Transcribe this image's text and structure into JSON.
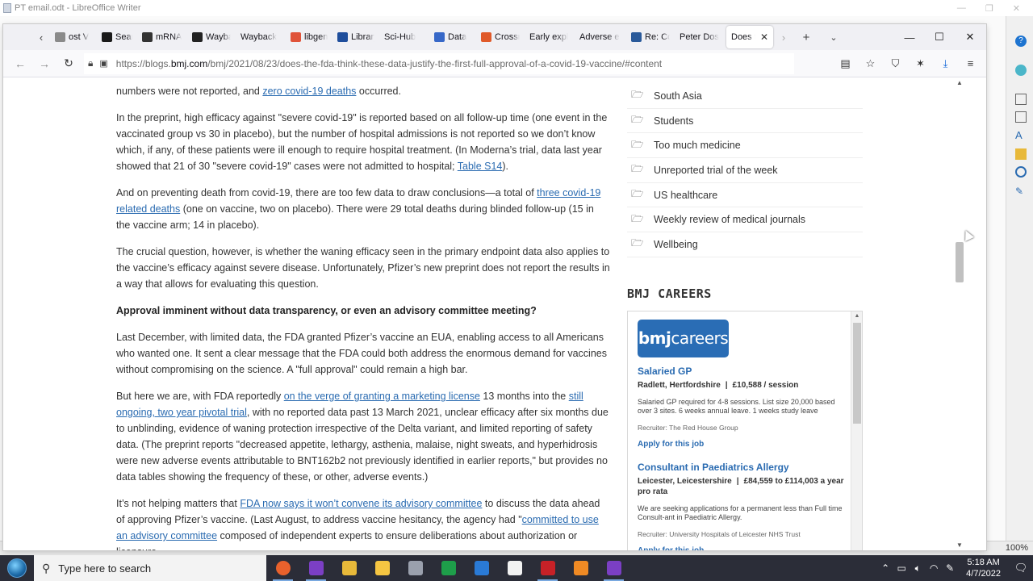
{
  "libreoffice": {
    "title": "PT email.odt - LibreOffice Writer",
    "zoom": "100%"
  },
  "firefox": {
    "tabs": [
      {
        "label": "ost V",
        "icon": "generic-tab-icon",
        "color": "#8a8a8a"
      },
      {
        "label": "Search",
        "icon": "ct-icon",
        "color": "#1a1a1a"
      },
      {
        "label": "mRNA",
        "icon": "arrow-icon",
        "color": "#333333"
      },
      {
        "label": "Wayback",
        "icon": "wayback-icon",
        "color": "#222222"
      },
      {
        "label": "Wayback",
        "icon": "none",
        "color": "#ffffff"
      },
      {
        "label": "libgen",
        "icon": "libgen-icon",
        "color": "#e0533a"
      },
      {
        "label": "Library",
        "icon": "library-icon",
        "color": "#1f4e9c"
      },
      {
        "label": "Sci-Hub",
        "icon": "none",
        "color": "#ffffff"
      },
      {
        "label": "Data",
        "icon": "data-icon",
        "color": "#3768c8"
      },
      {
        "label": "Crossref",
        "icon": "crossref-icon",
        "color": "#e05a2a"
      },
      {
        "label": "Early expl",
        "icon": "none",
        "color": "#ffffff"
      },
      {
        "label": "Adverse e",
        "icon": "none",
        "color": "#ffffff"
      },
      {
        "label": "Re: Co",
        "icon": "bmj-icon",
        "color": "#2a5a9a"
      },
      {
        "label": "Peter Dos",
        "icon": "none",
        "color": "#ffffff"
      },
      {
        "label": "Does th",
        "icon": "none",
        "color": "#ffffff",
        "active": true
      }
    ],
    "url_prefix": "https://blogs.",
    "url_domain": "bmj.com",
    "url_rest": "/bmj/2021/08/23/does-the-fda-think-these-data-justify-the-first-full-approval-of-a-covid-19-vaccine/#content"
  },
  "article": {
    "p0_text": "numbers were not reported, and ",
    "p0_link": "zero covid-19 deaths",
    "p0_tail": " occurred.",
    "p1_a": "In the preprint, high efficacy against \"severe covid-19\" is reported based on all follow-up time (one event in the vaccinated group vs 30 in placebo), but the number of hospital admissions is not reported so we don’t know which, if any, of these patients were ill enough to require hospital treatment. (In Moderna’s trial, data last year showed that 21 of 30 \"severe covid-19\" cases were not admitted to hospital; ",
    "p1_link": "Table S14",
    "p1_b": ").",
    "p2_a": "And on preventing death from covid-19, there are too few data to draw conclusions—a total of ",
    "p2_link": "three covid-19 related deaths",
    "p2_b": " (one on vaccine, two on placebo). There were 29 total deaths during blinded follow-up (15 in the vaccine arm; 14 in placebo).",
    "p3": "The crucial question, however, is whether the waning efficacy seen in the primary endpoint data also applies to the vaccine’s efficacy against severe disease. Unfortunately, Pfizer’s new preprint does not report the results in a way that allows for evaluating this question.",
    "heading": "Approval imminent without data transparency, or even an advisory committee meeting?",
    "p4": "Last December, with limited data, the FDA granted Pfizer’s vaccine an EUA, enabling access to all Americans who wanted one. It sent a clear message that the FDA could both address the enormous demand for vaccines without compromising on the science. A \"full approval\" could remain a high bar.",
    "p5_a": "But here we are, with FDA reportedly ",
    "p5_link1": "on the verge of granting a marketing license",
    "p5_b": " 13 months into the ",
    "p5_link2": "still ongoing, two year pivotal trial",
    "p5_c": ", with no reported data past 13 March 2021, unclear efficacy after six months due to unblinding, evidence of waning protection irrespective of the Delta variant, and limited reporting of safety data. (The preprint reports \"decreased appetite, lethargy, asthenia, malaise, night sweats, and hyperhidrosis were new adverse events attributable to BNT162b2 not previously identified in earlier reports,\" but provides no data tables showing the frequency of these, or other, adverse events.)",
    "p6_a": "It’s not helping matters that ",
    "p6_link1": "FDA now says it won’t convene its advisory committee",
    "p6_b": " to discuss the data ahead of approving Pfizer’s vaccine. (Last August, to address vaccine hesitancy, the agency had \"",
    "p6_link2": "committed to use an advisory committee",
    "p6_c": " composed of independent experts to ensure deliberations about authorization or licensure"
  },
  "sidebar": {
    "categories": [
      "South Asia",
      "Students",
      "Too much medicine",
      "Unreported trial of the week",
      "US healthcare",
      "Weekly review of medical journals",
      "Wellbeing"
    ],
    "careers_title": "BMJ CAREERS",
    "logo_bold": "bmj",
    "logo_rest": "careers",
    "jobs": [
      {
        "title": "Salaried GP",
        "location": "Radlett, Hertfordshire",
        "salary": "£10,588 / session",
        "description": "Salaried GP required for 4-8 sessions. List size 20,000 based over 3 sites. 6 weeks annual leave. 1 weeks study leave",
        "recruiter": "Recruiter: The Red House Group",
        "apply": "Apply for this job"
      },
      {
        "title": "Consultant in Paediatrics Allergy",
        "location": "Leicester, Leicestershire",
        "salary": "£84,559 to £114,003 a year pro rata",
        "description": "We are seeking applications for a permanent less than Full time Consult-ant in Paediatric Allergy.",
        "recruiter": "Recruiter: University Hospitals of Leicester NHS Trust",
        "apply": "Apply for this job"
      }
    ]
  },
  "taskbar": {
    "search_placeholder": "Type here to search",
    "time": "5:18 AM",
    "date": "4/7/2022",
    "apps": [
      {
        "name": "firefox-icon",
        "color": "#e8612c"
      },
      {
        "name": "purple-app-icon",
        "color": "#7b3fc4"
      },
      {
        "name": "file-explorer-icon",
        "color": "#e8b93a"
      },
      {
        "name": "star-app-icon",
        "color": "#f5c542"
      },
      {
        "name": "clipboard-app-icon",
        "color": "#9aa0ad"
      },
      {
        "name": "calc-icon",
        "color": "#1e9e4a"
      },
      {
        "name": "writer-icon",
        "color": "#2a7ad6"
      },
      {
        "name": "document-icon",
        "color": "#f2f2f2"
      },
      {
        "name": "acrobat-icon",
        "color": "#c72127"
      },
      {
        "name": "orange-app-icon",
        "color": "#f08a24"
      },
      {
        "name": "purple-app-2-icon",
        "color": "#7b3fc4"
      }
    ]
  }
}
